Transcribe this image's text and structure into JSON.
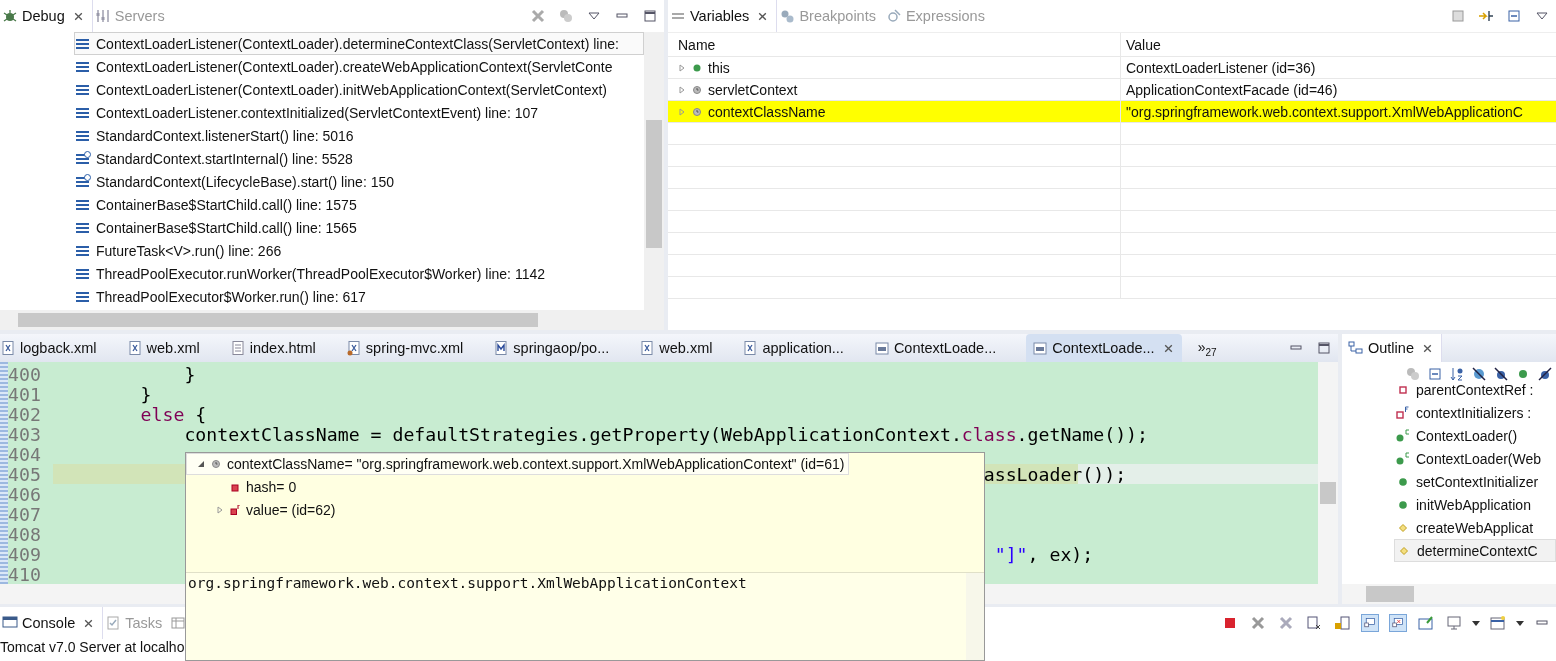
{
  "debug_panel": {
    "tabs": [
      {
        "label": "Debug",
        "selected": true,
        "kind": "bug"
      },
      {
        "label": "Servers",
        "selected": false,
        "kind": "servers"
      }
    ],
    "frames": [
      {
        "text": "ContextLoaderListener(ContextLoader).determineContextClass(ServletContext) line:",
        "kind": "frame",
        "selected": true
      },
      {
        "text": "ContextLoaderListener(ContextLoader).createWebApplicationContext(ServletConte",
        "kind": "frame",
        "selected": false
      },
      {
        "text": "ContextLoaderListener(ContextLoader).initWebApplicationContext(ServletContext)",
        "kind": "frame",
        "selected": false
      },
      {
        "text": "ContextLoaderListener.contextInitialized(ServletContextEvent) line: 107",
        "kind": "frame",
        "selected": false
      },
      {
        "text": "StandardContext.listenerStart() line: 5016",
        "kind": "frame",
        "selected": false
      },
      {
        "text": "StandardContext.startInternal() line: 5528",
        "kind": "sync",
        "selected": false
      },
      {
        "text": "StandardContext(LifecycleBase).start() line: 150",
        "kind": "sync",
        "selected": false
      },
      {
        "text": "ContainerBase$StartChild.call() line: 1575",
        "kind": "frame",
        "selected": false
      },
      {
        "text": "ContainerBase$StartChild.call() line: 1565",
        "kind": "frame",
        "selected": false
      },
      {
        "text": "FutureTask<V>.run() line: 266",
        "kind": "frame",
        "selected": false
      },
      {
        "text": "ThreadPoolExecutor.runWorker(ThreadPoolExecutor$Worker) line: 1142",
        "kind": "frame",
        "selected": false
      },
      {
        "text": "ThreadPoolExecutor$Worker.run() line: 617",
        "kind": "frame",
        "selected": false
      }
    ]
  },
  "variables_panel": {
    "tabs": [
      {
        "label": "Variables",
        "selected": true,
        "kind": "vars"
      },
      {
        "label": "Breakpoints",
        "selected": false,
        "kind": "breakpoints"
      },
      {
        "label": "Expressions",
        "selected": false,
        "kind": "expressions"
      }
    ],
    "columns": [
      "Name",
      "Value"
    ],
    "rows": [
      {
        "name": "this",
        "value": "ContextLoaderListener  (id=36)",
        "kind": "public",
        "selected": false
      },
      {
        "name": "servletContext",
        "value": "ApplicationContextFacade  (id=46)",
        "kind": "local",
        "selected": false
      },
      {
        "name": "contextClassName",
        "value": "\"org.springframework.web.context.support.XmlWebApplicationC",
        "kind": "local",
        "selected": true
      }
    ]
  },
  "editor": {
    "tabs": [
      {
        "label": "logback.xml",
        "kind": "xml",
        "selected": false
      },
      {
        "label": "web.xml",
        "kind": "xml",
        "selected": false
      },
      {
        "label": "index.html",
        "kind": "doc",
        "selected": false
      },
      {
        "label": "spring-mvc.xml",
        "kind": "xmlspring",
        "selected": false
      },
      {
        "label": "springaop/po...",
        "kind": "maven",
        "selected": false
      },
      {
        "label": "web.xml",
        "kind": "xml",
        "selected": false
      },
      {
        "label": "application...",
        "kind": "xml",
        "selected": false
      },
      {
        "label": "ContextLoade...",
        "kind": "class",
        "selected": false
      },
      {
        "label": "ContextLoade...",
        "kind": "class",
        "selected": true
      }
    ],
    "overflow_marker": "»",
    "overflow_count": "27",
    "lines": [
      {
        "number": "400",
        "current": false,
        "tokens": [
          {
            "text": "            }",
            "kind": "plain"
          }
        ]
      },
      {
        "number": "401",
        "current": false,
        "tokens": [
          {
            "text": "        }",
            "kind": "plain"
          }
        ]
      },
      {
        "number": "402",
        "current": false,
        "tokens": [
          {
            "text": "        else",
            "kind": "keyword"
          },
          {
            "text": " {",
            "kind": "plain"
          }
        ]
      },
      {
        "number": "403",
        "current": false,
        "tokens": [
          {
            "text": "            contextClassName = defaultStrategies.getProperty(WebApplicationContext.",
            "kind": "plain"
          },
          {
            "text": "class",
            "kind": "keyword"
          },
          {
            "text": ".getName());",
            "kind": "plain"
          }
        ]
      },
      {
        "number": "404",
        "current": false
      },
      {
        "number": "405",
        "current": true,
        "tokens": [
          {
            "text": "                                                                                     assLoader());",
            "kind": "plain"
          }
        ]
      },
      {
        "number": "406",
        "current": false
      },
      {
        "number": "407",
        "current": false
      },
      {
        "number": "408",
        "current": false
      },
      {
        "number": "409",
        "current": false,
        "tokens": [
          {
            "text": "                                                                                      \"]\"",
            "kind": "string"
          },
          {
            "text": ", ex);",
            "kind": "plain"
          }
        ]
      },
      {
        "number": "410",
        "current": false
      }
    ]
  },
  "hover_popup": {
    "root": {
      "text": "contextClassName= \"org.springframework.web.context.support.XmlWebApplicationContext\" (id=61)",
      "expanded": true
    },
    "children": [
      {
        "text": "hash= 0",
        "kind": "field",
        "expandable": false
      },
      {
        "text": "value= (id=62)",
        "kind": "final",
        "expandable": true
      }
    ],
    "detail": "org.springframework.web.context.support.XmlWebApplicationContext"
  },
  "outline_panel": {
    "title": "Outline",
    "items": [
      {
        "text": "parentContextRef :",
        "kind": "private",
        "selected": false
      },
      {
        "text": "contextInitializers :",
        "kind": "private_final",
        "selected": false
      },
      {
        "text": "ContextLoader()",
        "kind": "constructor",
        "selected": false
      },
      {
        "text": "ContextLoader(Web",
        "kind": "constructor",
        "selected": false
      },
      {
        "text": "setContextInitializer",
        "kind": "public",
        "selected": false
      },
      {
        "text": "initWebApplication",
        "kind": "public",
        "selected": false
      },
      {
        "text": "createWebApplicat",
        "kind": "protected",
        "selected": false
      },
      {
        "text": "determineContextC",
        "kind": "protected",
        "selected": true
      }
    ]
  },
  "console_panel": {
    "tabs": [
      {
        "label": "Console",
        "selected": true,
        "kind": "console"
      },
      {
        "label": "Tasks",
        "selected": false,
        "kind": "tasks"
      }
    ],
    "text": "Tomcat v7.0 Server at localho"
  }
}
